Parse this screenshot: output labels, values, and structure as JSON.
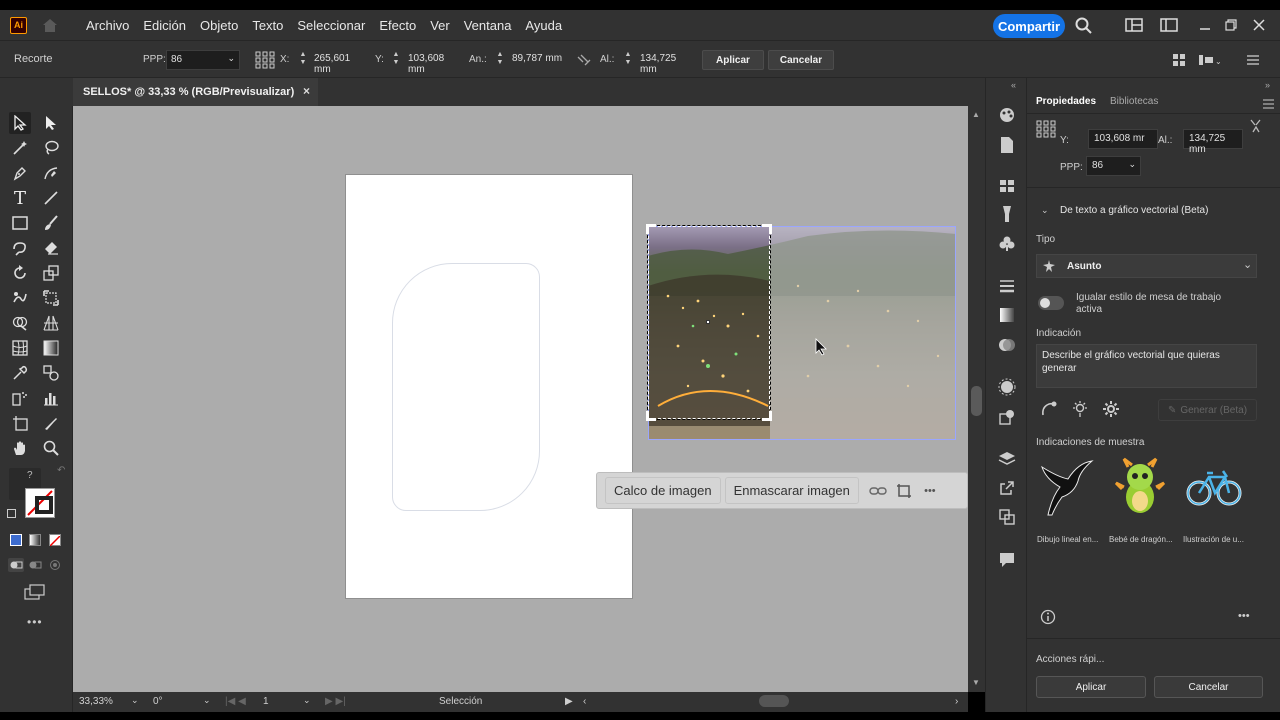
{
  "app": {
    "logo_text": "Ai"
  },
  "menu": [
    "Archivo",
    "Edición",
    "Objeto",
    "Texto",
    "Seleccionar",
    "Efecto",
    "Ver",
    "Ventana",
    "Ayuda"
  ],
  "share_label": "Compartir",
  "control_bar": {
    "mode_label": "Recorte",
    "ppp_label": "PPP:",
    "ppp_value": "86",
    "x_label": "X:",
    "x_value": "265,601 mm",
    "y_label": "Y:",
    "y_value": "103,608 mm",
    "w_label": "An.:",
    "w_value": "89,787 mm",
    "h_label": "Al.:",
    "h_value": "134,725 mm",
    "apply_label": "Aplicar",
    "cancel_label": "Cancelar"
  },
  "document_tab": {
    "title": "SELLOS* @ 33,33 % (RGB/Previsualizar)",
    "close": "×"
  },
  "context_bar": {
    "trace_label": "Calco de imagen",
    "mask_label": "Enmascarar imagen",
    "more": "•••"
  },
  "status_bar": {
    "zoom": "33,33%",
    "rotation": "0°",
    "artboard": "1",
    "tool": "Selección"
  },
  "panel": {
    "tab_properties": "Propiedades",
    "tab_libraries": "Bibliotecas",
    "y_label": "Y:",
    "y_value": "103,608 mr",
    "h_label": "Al.:",
    "h_value": "134,725 mm",
    "ppp_label": "PPP:",
    "ppp_value": "86",
    "section_title": "De texto a gráfico vectorial (Beta)",
    "type_label": "Tipo",
    "type_value": "Asunto",
    "toggle_label": "Igualar estilo de mesa de trabajo activa",
    "prompt_label": "Indicación",
    "prompt_text": "Describe el gráfico vectorial que quieras generar",
    "generate_label": "Generar (Beta)",
    "samples_label": "Indicaciones de muestra",
    "samples": [
      "Dibujo lineal en...",
      "Bebé de dragón...",
      "Ilustración de u..."
    ],
    "quick_actions": "Acciones rápi...",
    "apply_label": "Aplicar",
    "cancel_label": "Cancelar",
    "more": "•••"
  }
}
